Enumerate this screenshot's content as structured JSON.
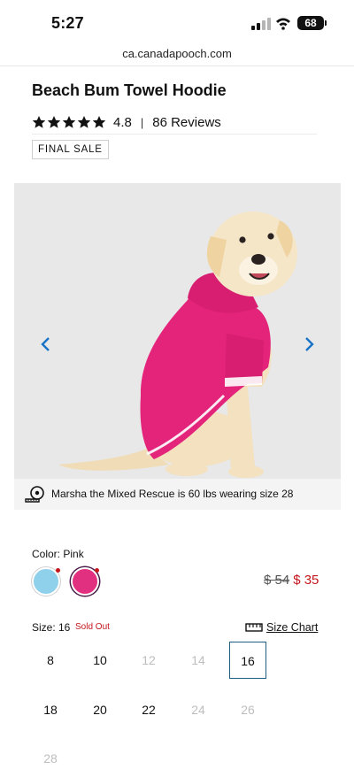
{
  "status_bar": {
    "time": "5:27",
    "battery": "68"
  },
  "browser": {
    "url": "ca.canadapooch.com"
  },
  "product": {
    "title": "Beach Bum Towel Hoodie",
    "rating": "4.8",
    "rating_separator": "|",
    "reviews": "86 Reviews",
    "badge": "FINAL SALE"
  },
  "gallery": {
    "caption": "Marsha the Mixed Rescue is 60 lbs wearing size 28",
    "arrow_color": "#1a73c6"
  },
  "color": {
    "label": "Color: Pink",
    "swatches": [
      {
        "name": "blue",
        "color": "#8fd0ea",
        "selected": false
      },
      {
        "name": "pink",
        "color": "#e0307f",
        "selected": true
      }
    ]
  },
  "price": {
    "original": "$ 54",
    "sale": "$ 35"
  },
  "size": {
    "label": "Size: 16",
    "sold_out": "Sold Out",
    "chart_label": "Size Chart",
    "options": [
      {
        "label": "8",
        "available": true,
        "selected": false
      },
      {
        "label": "10",
        "available": true,
        "selected": false
      },
      {
        "label": "12",
        "available": false,
        "selected": false
      },
      {
        "label": "14",
        "available": false,
        "selected": false
      },
      {
        "label": "16",
        "available": true,
        "selected": true
      },
      {
        "label": "18",
        "available": true,
        "selected": false
      },
      {
        "label": "20",
        "available": true,
        "selected": false
      },
      {
        "label": "22",
        "available": true,
        "selected": false
      },
      {
        "label": "24",
        "available": false,
        "selected": false
      },
      {
        "label": "26",
        "available": false,
        "selected": false
      },
      {
        "label": "28",
        "available": false,
        "selected": false
      }
    ]
  }
}
